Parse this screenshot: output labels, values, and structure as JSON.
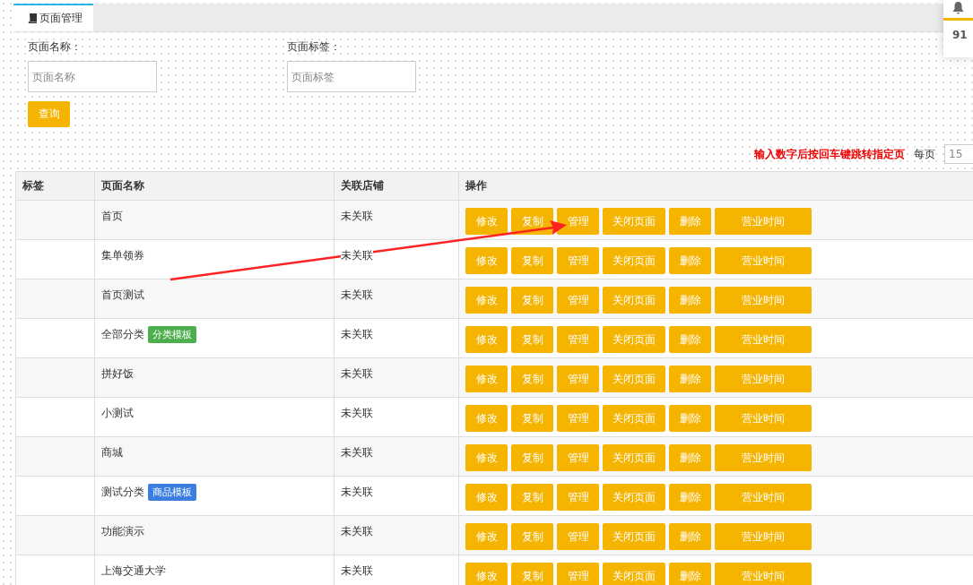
{
  "tabs": [
    {
      "label": "页面管理",
      "selected": true
    }
  ],
  "notification": {
    "count": "91"
  },
  "filters": [
    {
      "label": "页面名称：",
      "placeholder": "页面名称"
    },
    {
      "label": "页面标签：",
      "placeholder": "页面标签"
    }
  ],
  "query_button": "查询",
  "pagination": {
    "hint": "输入数字后按回车键跳转指定页",
    "per_page_label": "每页",
    "per_page_value": "15"
  },
  "table": {
    "columns": [
      "标签",
      "页面名称",
      "关联店铺",
      "操作"
    ],
    "rows": [
      {
        "tag": "",
        "name": "首页",
        "store": "未关联",
        "actions": [
          "修改",
          "复制",
          "管理",
          "关闭页面",
          "删除",
          "营业时间"
        ]
      },
      {
        "tag": "",
        "name": "集单领券",
        "store": "未关联",
        "actions": [
          "修改",
          "复制",
          "管理",
          "关闭页面",
          "删除",
          "营业时间"
        ]
      },
      {
        "tag": "",
        "name": "首页测试",
        "store": "未关联",
        "actions": [
          "修改",
          "复制",
          "管理",
          "关闭页面",
          "删除",
          "营业时间"
        ]
      },
      {
        "tag": "",
        "name": "全部分类",
        "badge": {
          "text": "分类模板",
          "color": "#4cae4c"
        },
        "store": "未关联",
        "actions": [
          "修改",
          "复制",
          "管理",
          "关闭页面",
          "删除",
          "营业时间"
        ]
      },
      {
        "tag": "",
        "name": "拼好饭",
        "store": "未关联",
        "actions": [
          "修改",
          "复制",
          "管理",
          "关闭页面",
          "删除",
          "营业时间"
        ]
      },
      {
        "tag": "",
        "name": "小测试",
        "store": "未关联",
        "actions": [
          "修改",
          "复制",
          "管理",
          "关闭页面",
          "删除",
          "营业时间"
        ]
      },
      {
        "tag": "",
        "name": "商城",
        "store": "未关联",
        "actions": [
          "修改",
          "复制",
          "管理",
          "关闭页面",
          "删除",
          "营业时间"
        ]
      },
      {
        "tag": "",
        "name": "测试分类",
        "badge": {
          "text": "商品模板",
          "color": "#3b7de0"
        },
        "store": "未关联",
        "actions": [
          "修改",
          "复制",
          "管理",
          "关闭页面",
          "删除",
          "营业时间"
        ]
      },
      {
        "tag": "",
        "name": "功能演示",
        "store": "未关联",
        "actions": [
          "修改",
          "复制",
          "管理",
          "关闭页面",
          "删除",
          "营业时间"
        ]
      },
      {
        "tag": "",
        "name": "上海交通大学",
        "store": "未关联",
        "actions": [
          "修改",
          "复制",
          "管理",
          "关闭页面",
          "删除",
          "营业时间"
        ]
      }
    ]
  }
}
